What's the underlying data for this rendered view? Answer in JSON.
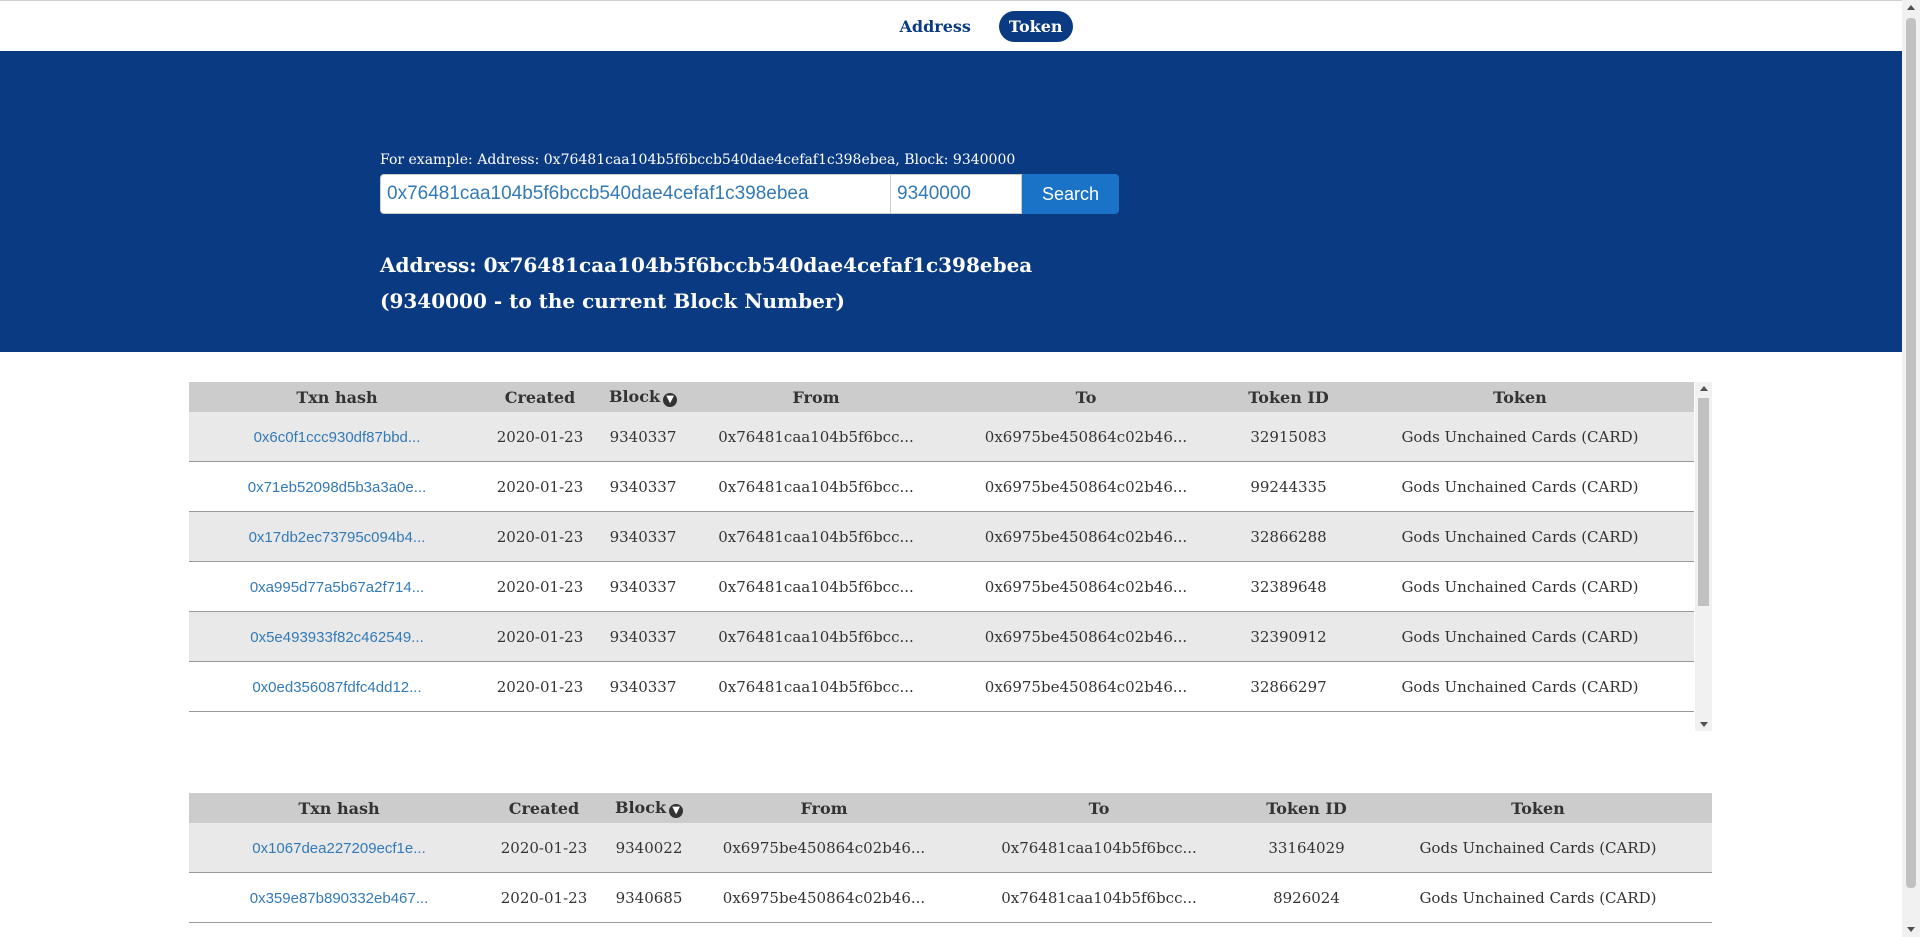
{
  "nav": {
    "tabs": [
      {
        "label": "Address",
        "active": false
      },
      {
        "label": "Token",
        "active": true
      }
    ]
  },
  "search": {
    "example": "For example: Address: 0x76481caa104b5f6bccb540dae4cefaf1c398ebea, Block: 9340000",
    "address_value": "0x76481caa104b5f6bccb540dae4cefaf1c398ebea",
    "block_value": "9340000",
    "button_label": "Search"
  },
  "result": {
    "title": "Address: 0x76481caa104b5f6bccb540dae4cefaf1c398ebea",
    "subtitle": "(9340000 - to the current Block Number)"
  },
  "columns": [
    "Txn hash",
    "Created",
    "Block",
    "From",
    "To",
    "Token ID",
    "Token"
  ],
  "colors": {
    "brand": "#0a3b82",
    "button": "#1a73c6",
    "link": "#337ab7"
  },
  "table_out": {
    "rows": [
      {
        "hash": "0x6c0f1ccc930df87bbd...",
        "created": "2020-01-23",
        "block": "9340337",
        "from": "0x76481caa104b5f6bcc...",
        "to": "0x6975be450864c02b46...",
        "token_id": "32915083",
        "token": "Gods Unchained Cards (CARD)"
      },
      {
        "hash": "0x71eb52098d5b3a3a0e...",
        "created": "2020-01-23",
        "block": "9340337",
        "from": "0x76481caa104b5f6bcc...",
        "to": "0x6975be450864c02b46...",
        "token_id": "99244335",
        "token": "Gods Unchained Cards (CARD)"
      },
      {
        "hash": "0x17db2ec73795c094b4...",
        "created": "2020-01-23",
        "block": "9340337",
        "from": "0x76481caa104b5f6bcc...",
        "to": "0x6975be450864c02b46...",
        "token_id": "32866288",
        "token": "Gods Unchained Cards (CARD)"
      },
      {
        "hash": "0xa995d77a5b67a2f714...",
        "created": "2020-01-23",
        "block": "9340337",
        "from": "0x76481caa104b5f6bcc...",
        "to": "0x6975be450864c02b46...",
        "token_id": "32389648",
        "token": "Gods Unchained Cards (CARD)"
      },
      {
        "hash": "0x5e493933f82c462549...",
        "created": "2020-01-23",
        "block": "9340337",
        "from": "0x76481caa104b5f6bcc...",
        "to": "0x6975be450864c02b46...",
        "token_id": "32390912",
        "token": "Gods Unchained Cards (CARD)"
      },
      {
        "hash": "0x0ed356087fdfc4dd12...",
        "created": "2020-01-23",
        "block": "9340337",
        "from": "0x76481caa104b5f6bcc...",
        "to": "0x6975be450864c02b46...",
        "token_id": "32866297",
        "token": "Gods Unchained Cards (CARD)"
      }
    ]
  },
  "table_in": {
    "rows": [
      {
        "hash": "0x1067dea227209ecf1e...",
        "created": "2020-01-23",
        "block": "9340022",
        "from": "0x6975be450864c02b46...",
        "to": "0x76481caa104b5f6bcc...",
        "token_id": "33164029",
        "token": "Gods Unchained Cards (CARD)"
      },
      {
        "hash": "0x359e87b890332eb467...",
        "created": "2020-01-23",
        "block": "9340685",
        "from": "0x6975be450864c02b46...",
        "to": "0x76481caa104b5f6bcc...",
        "token_id": "8926024",
        "token": "Gods Unchained Cards (CARD)"
      }
    ]
  }
}
